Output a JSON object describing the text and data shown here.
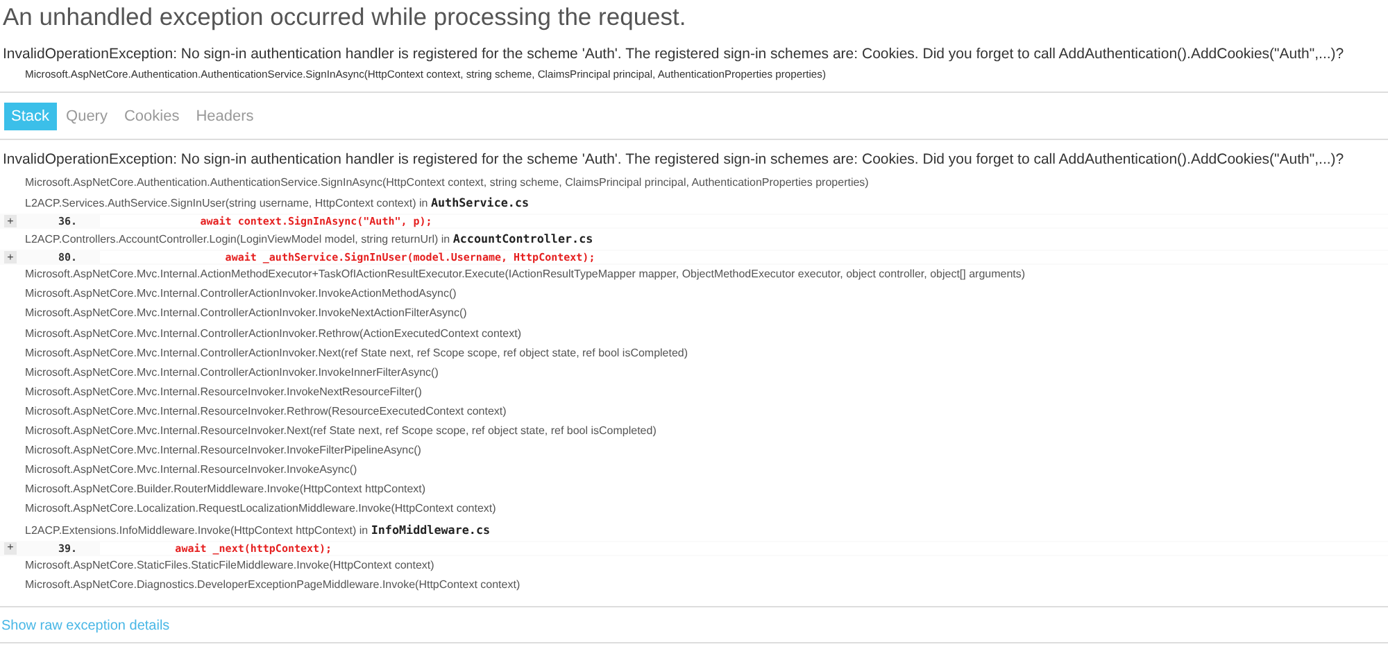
{
  "title": "An unhandled exception occurred while processing the request.",
  "error": {
    "message": "InvalidOperationException: No sign-in authentication handler is registered for the scheme 'Auth'. The registered sign-in schemes are: Cookies. Did you forget to call AddAuthentication().AddCookies(\"Auth\",...)?",
    "location": "Microsoft.AspNetCore.Authentication.AuthenticationService.SignInAsync(HttpContext context, string scheme, ClaimsPrincipal principal, AuthenticationProperties properties)"
  },
  "tabs": [
    {
      "label": "Stack",
      "selected": true
    },
    {
      "label": "Query",
      "selected": false
    },
    {
      "label": "Cookies",
      "selected": false
    },
    {
      "label": "Headers",
      "selected": false
    }
  ],
  "stack": {
    "message": "InvalidOperationException: No sign-in authentication handler is registered for the scheme 'Auth'. The registered sign-in schemes are: Cookies. Did you forget to call AddAuthentication().AddCookies(\"Auth\",...)?",
    "frames": [
      {
        "kind": "frame",
        "method": "Microsoft.AspNetCore.Authentication.AuthenticationService.SignInAsync(HttpContext context, string scheme, ClaimsPrincipal principal, AuthenticationProperties properties)"
      },
      {
        "kind": "frame",
        "method": "L2ACP.Services.AuthService.SignInUser(string username, HttpContext context) in",
        "file": "AuthService.cs"
      },
      {
        "kind": "code",
        "toggle": "+",
        "line": "36.",
        "code": "                await context.SignInAsync(\"Auth\", p);"
      },
      {
        "kind": "frame",
        "method": "L2ACP.Controllers.AccountController.Login(LoginViewModel model, string returnUrl) in",
        "file": "AccountController.cs"
      },
      {
        "kind": "code",
        "toggle": "+",
        "line": "80.",
        "code": "                    await _authService.SignInUser(model.Username, HttpContext);"
      },
      {
        "kind": "frame",
        "method": "Microsoft.AspNetCore.Mvc.Internal.ActionMethodExecutor+TaskOfIActionResultExecutor.Execute(IActionResultTypeMapper mapper, ObjectMethodExecutor executor, object controller, object[] arguments)"
      },
      {
        "kind": "frame",
        "method": "Microsoft.AspNetCore.Mvc.Internal.ControllerActionInvoker.InvokeActionMethodAsync()"
      },
      {
        "kind": "frame",
        "method": "Microsoft.AspNetCore.Mvc.Internal.ControllerActionInvoker.InvokeNextActionFilterAsync()"
      },
      {
        "kind": "frame",
        "method": "Microsoft.AspNetCore.Mvc.Internal.ControllerActionInvoker.Rethrow(ActionExecutedContext context)"
      },
      {
        "kind": "frame",
        "method": "Microsoft.AspNetCore.Mvc.Internal.ControllerActionInvoker.Next(ref State next, ref Scope scope, ref object state, ref bool isCompleted)"
      },
      {
        "kind": "frame",
        "method": "Microsoft.AspNetCore.Mvc.Internal.ControllerActionInvoker.InvokeInnerFilterAsync()"
      },
      {
        "kind": "frame",
        "method": "Microsoft.AspNetCore.Mvc.Internal.ResourceInvoker.InvokeNextResourceFilter()"
      },
      {
        "kind": "frame",
        "method": "Microsoft.AspNetCore.Mvc.Internal.ResourceInvoker.Rethrow(ResourceExecutedContext context)"
      },
      {
        "kind": "frame",
        "method": "Microsoft.AspNetCore.Mvc.Internal.ResourceInvoker.Next(ref State next, ref Scope scope, ref object state, ref bool isCompleted)"
      },
      {
        "kind": "frame",
        "method": "Microsoft.AspNetCore.Mvc.Internal.ResourceInvoker.InvokeFilterPipelineAsync()"
      },
      {
        "kind": "frame",
        "method": "Microsoft.AspNetCore.Mvc.Internal.ResourceInvoker.InvokeAsync()"
      },
      {
        "kind": "frame",
        "method": "Microsoft.AspNetCore.Builder.RouterMiddleware.Invoke(HttpContext httpContext)"
      },
      {
        "kind": "frame",
        "method": "Microsoft.AspNetCore.Localization.RequestLocalizationMiddleware.Invoke(HttpContext context)"
      },
      {
        "kind": "frame",
        "method": "L2ACP.Extensions.InfoMiddleware.Invoke(HttpContext httpContext) in",
        "file": "InfoMiddleware.cs"
      },
      {
        "kind": "code",
        "toggle": "+",
        "line": "39.",
        "code": "            await _next(httpContext);"
      },
      {
        "kind": "frame",
        "method": "Microsoft.AspNetCore.StaticFiles.StaticFileMiddleware.Invoke(HttpContext context)"
      },
      {
        "kind": "frame",
        "method": "Microsoft.AspNetCore.Diagnostics.DeveloperExceptionPageMiddleware.Invoke(HttpContext context)"
      }
    ]
  },
  "raw_link": "Show raw exception details"
}
